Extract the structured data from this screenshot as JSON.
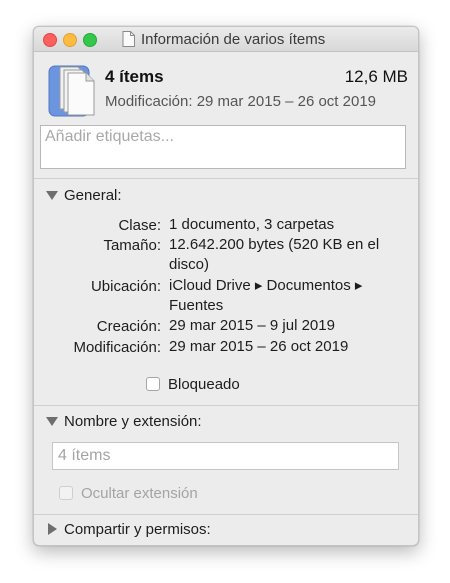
{
  "window": {
    "title": "Información de varios ítems"
  },
  "header": {
    "count": "4 ítems",
    "size": "12,6 MB",
    "modification": "Modificación: 29 mar 2015 – 26 oct 2019"
  },
  "tags": {
    "placeholder": "Añadir etiquetas..."
  },
  "general": {
    "title": "General:",
    "rows": [
      {
        "label": "Clase:",
        "value": "1 documento, 3 carpetas"
      },
      {
        "label": "Tamaño:",
        "value": "12.642.200 bytes (520 KB en el disco)"
      },
      {
        "label": "Ubicación:",
        "value": "iCloud Drive ▸ Documentos ▸ Fuentes"
      },
      {
        "label": "Creación:",
        "value": "29 mar 2015 – 9 jul 2019"
      },
      {
        "label": "Modificación:",
        "value": "29 mar 2015 – 26 oct 2019"
      }
    ],
    "locked_label": "Bloqueado"
  },
  "name_extension": {
    "title": "Nombre y extensión:",
    "name_placeholder": "4 ítems",
    "hide_extension_label": "Ocultar extensión"
  },
  "sharing": {
    "title": "Compartir y permisos:"
  },
  "colors": {
    "close": "#fc615d",
    "minimize": "#fdbc40",
    "maximize": "#34c84a",
    "window_bg": "#ececec"
  },
  "icons": [
    "close-icon",
    "minimize-icon",
    "maximize-icon",
    "document-icon",
    "multiple-documents-icon",
    "disclosure-triangle-down-icon",
    "disclosure-triangle-right-icon"
  ]
}
